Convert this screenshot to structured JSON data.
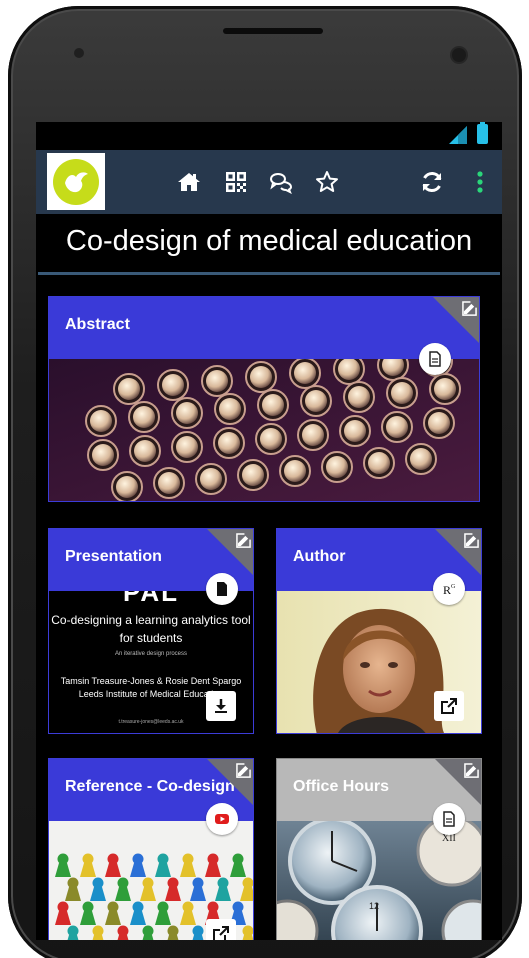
{
  "app": {
    "title": "Co-design of medical education"
  },
  "nav": {
    "icons": [
      "home-icon",
      "qr-code-icon",
      "chat-icon",
      "star-icon",
      "refresh-icon",
      "more-vert-icon"
    ]
  },
  "cards": {
    "abstract": {
      "label": "Abstract"
    },
    "presentation": {
      "label": "Presentation",
      "slide": {
        "big": "\"PAL\"",
        "line1": "Co-designing a learning analytics tool",
        "line2": "for students",
        "line3": "An iterative design process",
        "line4": "Tamsin Treasure-Jones & Rosie Dent Spargo",
        "line5": "Leeds Institute of Medical Education",
        "line6": "t.treasure-jones@leeds.ac.uk"
      }
    },
    "author": {
      "label": "Author"
    },
    "reference": {
      "label": "Reference - Co-design"
    },
    "office_hours": {
      "label": "Office Hours"
    }
  },
  "colors": {
    "card_header": "#3a3ad8",
    "card_header_disabled": "#b8b8b8",
    "app_bar": "#27384d",
    "logo_accent": "#c6dc1a",
    "menu_dots": "#2ad67a"
  }
}
